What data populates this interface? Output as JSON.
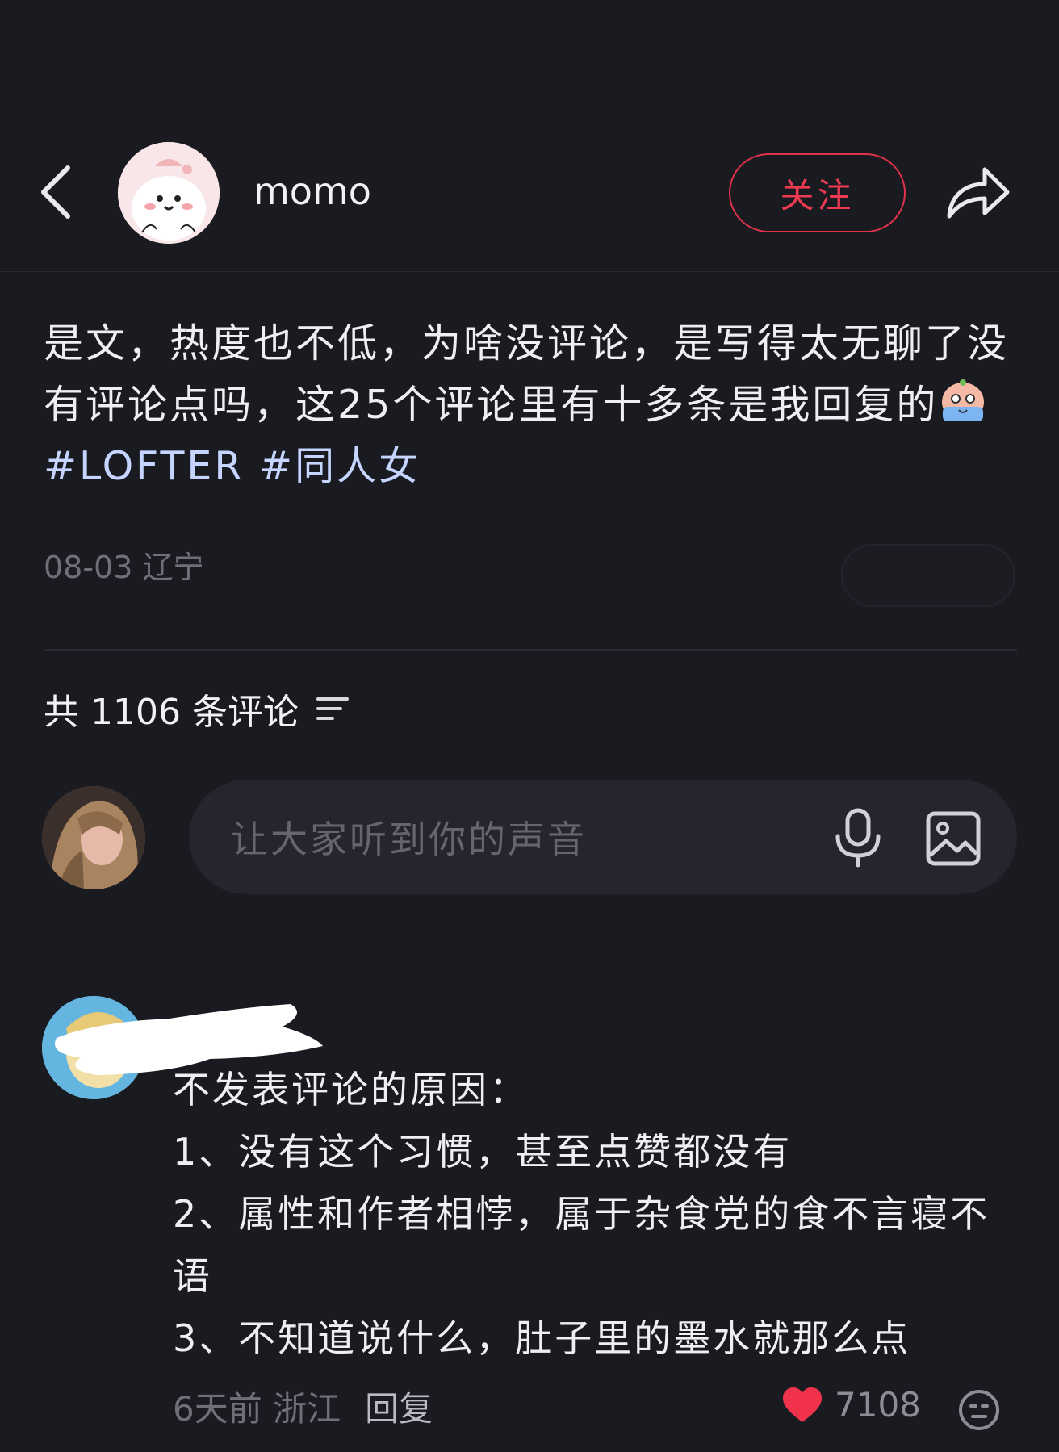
{
  "header": {
    "username": "momo",
    "follow_label": "关注"
  },
  "post": {
    "text_1": "是文，热度也不低，为啥没评论，是写得太无聊了没有评论点吗，这25个评论里有十多条是我回复的",
    "tags": [
      "#LOFTER",
      "#同人女"
    ],
    "date": "08-03",
    "location": "辽宁"
  },
  "comments_header": {
    "count_label": "共 1106 条评论"
  },
  "comment_input": {
    "placeholder": "让大家听到你的声音"
  },
  "comment": {
    "lines": [
      "不发表评论的原因：",
      "1、没有这个习惯，甚至点赞都没有",
      "2、属性和作者相悖，属于杂食党的食不言寝不语",
      "3、不知道说什么，肚子里的墨水就那么点"
    ],
    "time": "6天前",
    "location": "浙江",
    "reply_label": "回复",
    "likes": "7108"
  },
  "colors": {
    "background": "#1a1a21",
    "follow_accent": "#e0334b",
    "tag": "#c5d5ff",
    "heart": "#f0334b"
  }
}
